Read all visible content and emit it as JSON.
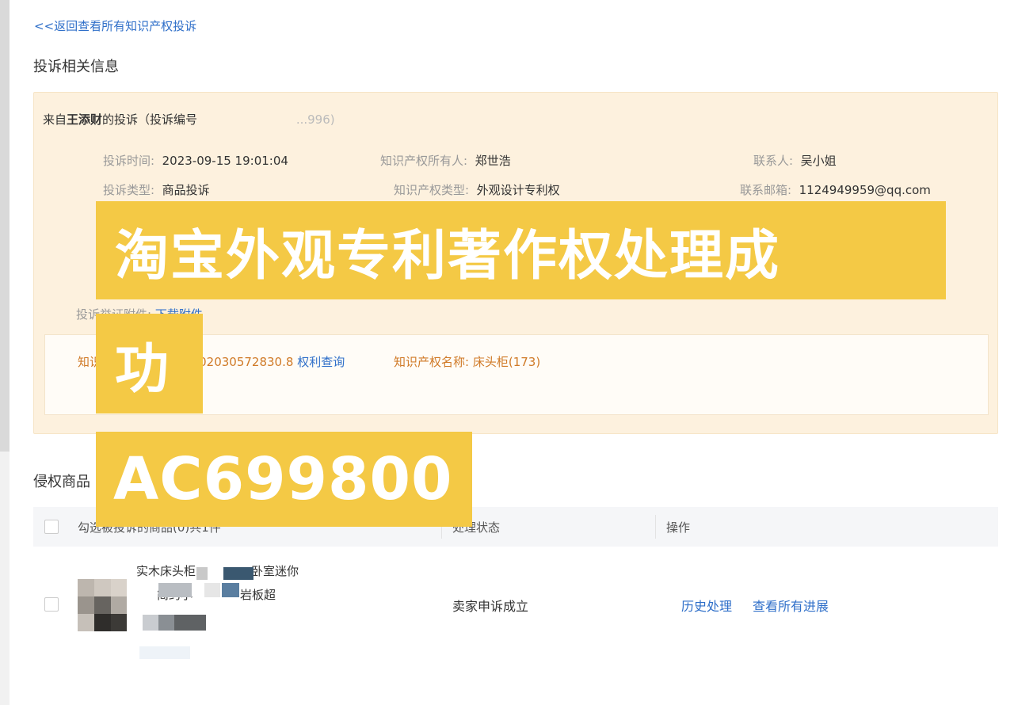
{
  "nav": {
    "back_link": "<<返回查看所有知识产权投诉"
  },
  "complaint": {
    "section_title": "投诉相关信息",
    "from_prefix": "来自",
    "complainant": "王添财",
    "from_suffix": "的投诉（投诉编号",
    "number_tail": "...996)",
    "time_label": "投诉时间:",
    "time_value": "2023-09-15 19:01:04",
    "type_label": "投诉类型:",
    "type_value": "商品投诉",
    "owner_label": "知识产权所有人:",
    "owner_value": "郑世浩",
    "ip_type_label": "知识产权类型:",
    "ip_type_value": "外观设计专利权",
    "contact_label": "联系人:",
    "contact_value": "吴小姐",
    "email_label": "联系邮箱:",
    "email_value": "1124949959@qq.com",
    "attachment_label": "投诉举证附件:",
    "attachment_link": "下载附件",
    "ip_number_label": "知识",
    "ip_number_value": "202030572830.8",
    "ip_query_link": "权利查询",
    "ip_name_label": "知识产权名称:",
    "ip_name_value": "床头柜(173)"
  },
  "infringing": {
    "section_title": "侵权商品",
    "columns": {
      "select": "勾选被投诉的商品(0)共1件",
      "status": "处理状态",
      "action": "操作"
    },
    "rows": [
      {
        "name_line1_a": "实木床头柜",
        "name_line1_b": "卧室迷你",
        "name_line2_a": "简约小",
        "name_line2_b": "岩板超",
        "status": "卖家申诉成立",
        "action_history": "历史处理",
        "action_progress": "查看所有进展"
      }
    ]
  },
  "overlay": {
    "line1": "淘宝外观专利著作权处理成",
    "line2": "功",
    "line3": "AC699800",
    "color": "#f4c945"
  }
}
